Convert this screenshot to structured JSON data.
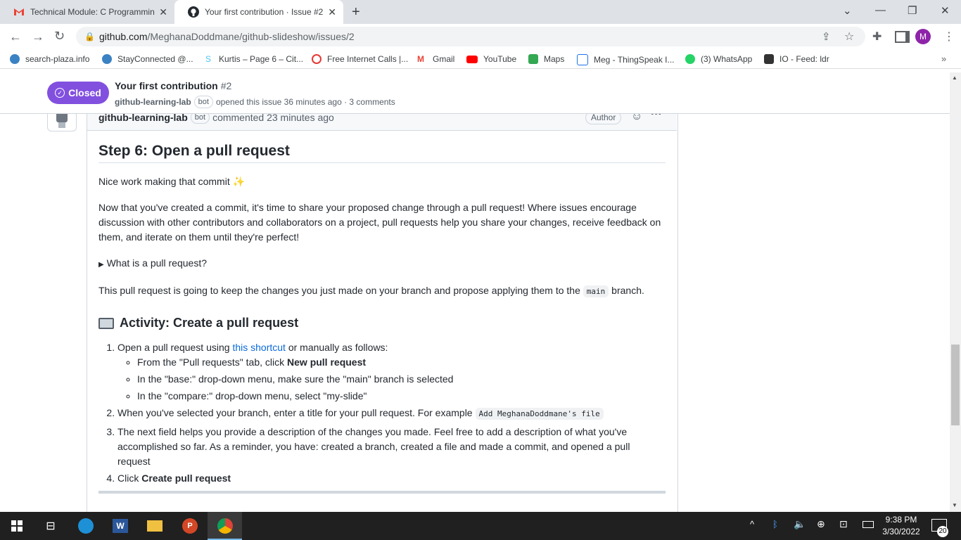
{
  "browser": {
    "tabs": [
      {
        "title": "Technical Module: C Programmin",
        "favicon": "gmail-icon"
      },
      {
        "title": "Your first contribution · Issue #2",
        "favicon": "github-icon"
      }
    ],
    "new_tab": "+",
    "url_host": "github.com",
    "url_path": "/MeghanaDoddmane/github-slideshow/issues/2",
    "profile_initial": "M",
    "bookmarks": [
      {
        "label": "search-plaza.info",
        "color": "#3b82c4"
      },
      {
        "label": "StayConnected @...",
        "color": "#3b82c4"
      },
      {
        "label": "Kurtis – Page 6 – Cit...",
        "color": "#4fc3f7"
      },
      {
        "label": "Free Internet Calls |...",
        "color": "#e53935"
      },
      {
        "label": "Gmail",
        "color": "#ea4335"
      },
      {
        "label": "YouTube",
        "color": "#ff0000"
      },
      {
        "label": "Maps",
        "color": "#34a853"
      },
      {
        "label": "Meg - ThingSpeak I...",
        "color": "#1a73e8"
      },
      {
        "label": "(3) WhatsApp",
        "color": "#25d366"
      },
      {
        "label": "IO - Feed: ldr",
        "color": "#333333"
      }
    ]
  },
  "issue": {
    "status": "Closed",
    "title": "Your first contribution",
    "number": "#2",
    "author": "github-learning-lab",
    "bot_label": "bot",
    "meta": "opened this issue 36 minutes ago · 3 comments",
    "status_color": "#8250df"
  },
  "comment": {
    "author": "github-learning-lab",
    "bot_label": "bot",
    "action": "commented 23 minutes ago",
    "role": "Author",
    "heading": "Step 6: Open a pull request",
    "p1": "Nice work making that commit",
    "p2": "Now that you've created a commit, it's time to share your proposed change through a pull request! Where issues encourage discussion with other contributors and collaborators on a project, pull requests help you share your changes, receive feedback on them, and iterate on them until they're perfect!",
    "details": "What is a pull request?",
    "p3_a": "This pull request is going to keep the changes you just made on your branch and propose applying them to the",
    "p3_code": "main",
    "p3_b": "branch.",
    "activity": "Activity: Create a pull request",
    "step1_a": "Open a pull request using",
    "step1_link": "this shortcut",
    "step1_b": "or manually as follows:",
    "sub1_a": "From the \"Pull requests\" tab, click",
    "sub1_b": "New pull request",
    "sub2": "In the \"base:\" drop-down menu, make sure the \"main\" branch is selected",
    "sub3": "In the \"compare:\" drop-down menu, select \"my-slide\"",
    "step2_a": "When you've selected your branch, enter a title for your pull request. For example",
    "step2_code": "Add MeghanaDoddmane's file",
    "step3": "The next field helps you provide a description of the changes you made. Feel free to add a description of what you've accomplished so far. As a reminder, you have: created a branch, created a file and made a commit, and opened a pull request",
    "step4_a": "Click",
    "step4_b": "Create pull request"
  },
  "taskbar": {
    "time": "9:38 PM",
    "date": "3/30/2022",
    "notifications": "20"
  }
}
